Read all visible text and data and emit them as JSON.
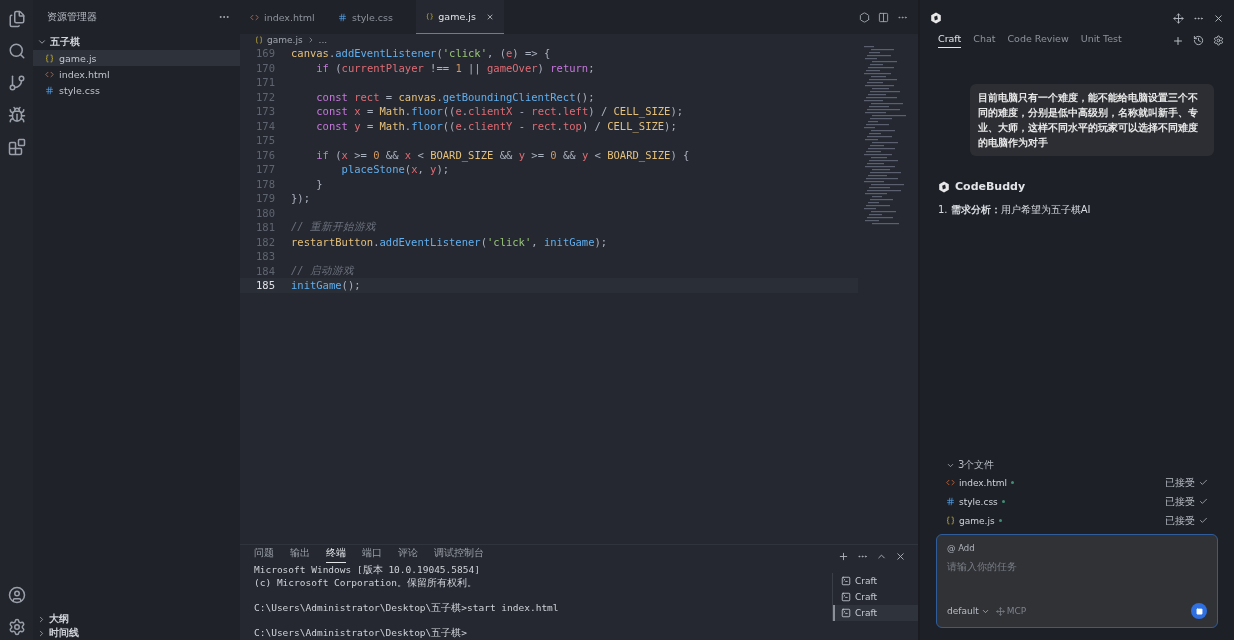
{
  "explorer": {
    "title": "资源管理器",
    "folder": {
      "name": "五子棋",
      "expanded": true,
      "children": [
        {
          "name": "game.js",
          "kind": "js",
          "selected": true
        },
        {
          "name": "index.html",
          "kind": "html",
          "selected": false
        },
        {
          "name": "style.css",
          "kind": "css",
          "selected": false
        }
      ]
    },
    "sections": [
      {
        "name": "大纲",
        "expanded": false
      },
      {
        "name": "时间线",
        "expanded": false
      }
    ]
  },
  "editor": {
    "tabs": [
      {
        "label": "index.html",
        "kind": "html",
        "selected": false
      },
      {
        "label": "style.css",
        "kind": "css",
        "selected": false
      },
      {
        "label": "game.js",
        "kind": "js",
        "selected": true
      }
    ],
    "breadcrumb": {
      "file": "game.js",
      "kind": "js",
      "rest": "..."
    },
    "lines": [
      {
        "number": "169",
        "current": false,
        "tokens": [
          {
            "kind": "cls",
            "text": "canvas"
          },
          {
            "kind": "plain",
            "text": "."
          },
          {
            "kind": "fn",
            "text": "addEventListener"
          },
          {
            "kind": "plain",
            "text": "("
          },
          {
            "kind": "str",
            "text": "'click'"
          },
          {
            "kind": "plain",
            "text": ", ("
          },
          {
            "kind": "var",
            "text": "e"
          },
          {
            "kind": "plain",
            "text": ") => {"
          }
        ]
      },
      {
        "number": "170",
        "current": false,
        "tokens": [
          {
            "kind": "kw",
            "text": "    if"
          },
          {
            "kind": "plain",
            "text": " ("
          },
          {
            "kind": "var",
            "text": "currentPlayer"
          },
          {
            "kind": "plain",
            "text": " !== "
          },
          {
            "kind": "num",
            "text": "1"
          },
          {
            "kind": "plain",
            "text": " || "
          },
          {
            "kind": "var",
            "text": "gameOver"
          },
          {
            "kind": "plain",
            "text": ") "
          },
          {
            "kind": "kw",
            "text": "return"
          },
          {
            "kind": "plain",
            "text": ";"
          }
        ]
      },
      {
        "number": "171",
        "current": false
      },
      {
        "number": "172",
        "current": false,
        "tokens": [
          {
            "kind": "kw",
            "text": "    const"
          },
          {
            "kind": "var",
            "text": " rect"
          },
          {
            "kind": "plain",
            "text": " = "
          },
          {
            "kind": "cls",
            "text": "canvas"
          },
          {
            "kind": "plain",
            "text": "."
          },
          {
            "kind": "fn",
            "text": "getBoundingClientRect"
          },
          {
            "kind": "plain",
            "text": "();"
          }
        ]
      },
      {
        "number": "173",
        "current": false,
        "tokens": [
          {
            "kind": "kw",
            "text": "    const"
          },
          {
            "kind": "var",
            "text": " x"
          },
          {
            "kind": "plain",
            "text": " = "
          },
          {
            "kind": "cls",
            "text": "Math"
          },
          {
            "kind": "plain",
            "text": "."
          },
          {
            "kind": "fn",
            "text": "floor"
          },
          {
            "kind": "plain",
            "text": "(("
          },
          {
            "kind": "var",
            "text": "e"
          },
          {
            "kind": "plain",
            "text": "."
          },
          {
            "kind": "var",
            "text": "clientX"
          },
          {
            "kind": "plain",
            "text": " - "
          },
          {
            "kind": "var",
            "text": "rect"
          },
          {
            "kind": "plain",
            "text": "."
          },
          {
            "kind": "var",
            "text": "left"
          },
          {
            "kind": "plain",
            "text": ") / "
          },
          {
            "kind": "cls",
            "text": "CELL_SIZE"
          },
          {
            "kind": "plain",
            "text": ");"
          }
        ]
      },
      {
        "number": "174",
        "current": false,
        "tokens": [
          {
            "kind": "kw",
            "text": "    const"
          },
          {
            "kind": "var",
            "text": " y"
          },
          {
            "kind": "plain",
            "text": " = "
          },
          {
            "kind": "cls",
            "text": "Math"
          },
          {
            "kind": "plain",
            "text": "."
          },
          {
            "kind": "fn",
            "text": "floor"
          },
          {
            "kind": "plain",
            "text": "(("
          },
          {
            "kind": "var",
            "text": "e"
          },
          {
            "kind": "plain",
            "text": "."
          },
          {
            "kind": "var",
            "text": "clientY"
          },
          {
            "kind": "plain",
            "text": " - "
          },
          {
            "kind": "var",
            "text": "rect"
          },
          {
            "kind": "plain",
            "text": "."
          },
          {
            "kind": "var",
            "text": "top"
          },
          {
            "kind": "plain",
            "text": ") / "
          },
          {
            "kind": "cls",
            "text": "CELL_SIZE"
          },
          {
            "kind": "plain",
            "text": ");"
          }
        ]
      },
      {
        "number": "175",
        "current": false
      },
      {
        "number": "176",
        "current": false,
        "tokens": [
          {
            "kind": "kw",
            "text": "    if"
          },
          {
            "kind": "plain",
            "text": " ("
          },
          {
            "kind": "var",
            "text": "x"
          },
          {
            "kind": "plain",
            "text": " >= "
          },
          {
            "kind": "num",
            "text": "0"
          },
          {
            "kind": "plain",
            "text": " && "
          },
          {
            "kind": "var",
            "text": "x"
          },
          {
            "kind": "plain",
            "text": " < "
          },
          {
            "kind": "cls",
            "text": "BOARD_SIZE"
          },
          {
            "kind": "plain",
            "text": " && "
          },
          {
            "kind": "var",
            "text": "y"
          },
          {
            "kind": "plain",
            "text": " >= "
          },
          {
            "kind": "num",
            "text": "0"
          },
          {
            "kind": "plain",
            "text": " && "
          },
          {
            "kind": "var",
            "text": "y"
          },
          {
            "kind": "plain",
            "text": " < "
          },
          {
            "kind": "cls",
            "text": "BOARD_SIZE"
          },
          {
            "kind": "plain",
            "text": ") {"
          }
        ]
      },
      {
        "number": "177",
        "current": false,
        "tokens": [
          {
            "kind": "fn",
            "text": "        placeStone"
          },
          {
            "kind": "plain",
            "text": "("
          },
          {
            "kind": "var",
            "text": "x"
          },
          {
            "kind": "plain",
            "text": ", "
          },
          {
            "kind": "var",
            "text": "y"
          },
          {
            "kind": "plain",
            "text": ");"
          }
        ]
      },
      {
        "number": "178",
        "current": false,
        "tokens": [
          {
            "kind": "plain",
            "text": "    }"
          }
        ]
      },
      {
        "number": "179",
        "current": false,
        "tokens": [
          {
            "kind": "plain",
            "text": "});"
          }
        ]
      },
      {
        "number": "180",
        "current": false
      },
      {
        "number": "181",
        "current": false,
        "tokens": [
          {
            "kind": "com",
            "text": "// 重新开始游戏"
          }
        ]
      },
      {
        "number": "182",
        "current": false,
        "tokens": [
          {
            "kind": "cls",
            "text": "restartButton"
          },
          {
            "kind": "plain",
            "text": "."
          },
          {
            "kind": "fn",
            "text": "addEventListener"
          },
          {
            "kind": "plain",
            "text": "("
          },
          {
            "kind": "str",
            "text": "'click'"
          },
          {
            "kind": "plain",
            "text": ", "
          },
          {
            "kind": "fn",
            "text": "initGame"
          },
          {
            "kind": "plain",
            "text": ");"
          }
        ]
      },
      {
        "number": "183",
        "current": false
      },
      {
        "number": "184",
        "current": false,
        "tokens": [
          {
            "kind": "com",
            "text": "// 启动游戏"
          }
        ]
      },
      {
        "number": "185",
        "current": true,
        "tokens": [
          {
            "kind": "fn",
            "text": "initGame"
          },
          {
            "kind": "plain",
            "text": "();"
          }
        ]
      }
    ]
  },
  "panel": {
    "tabs": [
      {
        "label": "问题",
        "selected": false
      },
      {
        "label": "输出",
        "selected": false
      },
      {
        "label": "终端",
        "selected": true
      },
      {
        "label": "端口",
        "selected": false
      },
      {
        "label": "评论",
        "selected": false
      },
      {
        "label": "调试控制台",
        "selected": false
      }
    ],
    "terminal_blocks": [
      [
        "Microsoft Windows [版本 10.0.19045.5854]",
        "(c) Microsoft Corporation。保留所有权利。"
      ],
      [
        "C:\\Users\\Administrator\\Desktop\\五子棋>start index.html"
      ],
      [
        "C:\\Users\\Administrator\\Desktop\\五子棋>"
      ]
    ],
    "terminals": [
      {
        "label": "Craft",
        "selected": false
      },
      {
        "label": "Craft",
        "selected": false
      },
      {
        "label": "Craft",
        "selected": true
      }
    ]
  },
  "assistant": {
    "tabs": [
      {
        "label": "Craft",
        "selected": true
      },
      {
        "label": "Chat",
        "selected": false
      },
      {
        "label": "Code Review",
        "selected": false
      },
      {
        "label": "Unit Test",
        "selected": false
      }
    ],
    "user_message": "目前电脑只有一个难度，能不能给电脑设置三个不同的难度，分别是低中高级别，名称就叫新手、专业、大师，这样不同水平的玩家可以选择不同难度的电脑作为对手",
    "bot_name": "CodeBuddy",
    "reply": "1. **需求分析：**用户希望为五子棋AI",
    "files": {
      "title": "3个文件",
      "expanded": true,
      "items": [
        {
          "name": "index.html",
          "kind": "html",
          "status": "已接受"
        },
        {
          "name": "style.css",
          "kind": "css",
          "status": "已接受"
        },
        {
          "name": "game.js",
          "kind": "js",
          "status": "已接受"
        }
      ]
    },
    "input": {
      "add_label": "@ Add",
      "placeholder": "请输入你的任务",
      "mode": "default",
      "mcp_label": "MCP"
    }
  }
}
